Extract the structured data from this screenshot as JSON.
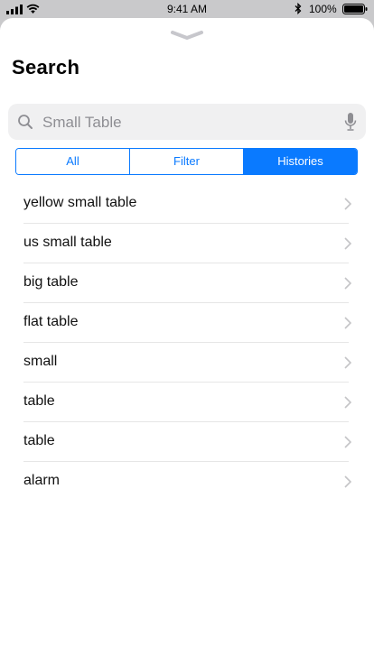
{
  "status_bar": {
    "time": "9:41 AM",
    "battery_percent": "100%",
    "icons": [
      "signal-icon",
      "wifi-icon",
      "bluetooth-icon",
      "battery-icon"
    ]
  },
  "sheet": {
    "title": "Search",
    "grabber_icon": "chevron-down-icon"
  },
  "search": {
    "placeholder": "Small Table",
    "value": "",
    "icons": [
      "search-icon",
      "microphone-icon"
    ]
  },
  "segments": [
    {
      "label": "All",
      "active": false
    },
    {
      "label": "Filter",
      "active": false
    },
    {
      "label": "Histories",
      "active": true
    }
  ],
  "histories": [
    {
      "label": "yellow small table"
    },
    {
      "label": "us small table"
    },
    {
      "label": "big table"
    },
    {
      "label": "flat table"
    },
    {
      "label": "small"
    },
    {
      "label": "table"
    },
    {
      "label": "table"
    },
    {
      "label": "alarm"
    }
  ],
  "colors": {
    "accent": "#0a7aff",
    "backdrop": "#c9c9cb",
    "search_bg": "#f0f0f1",
    "separator": "#e6e6e6"
  }
}
